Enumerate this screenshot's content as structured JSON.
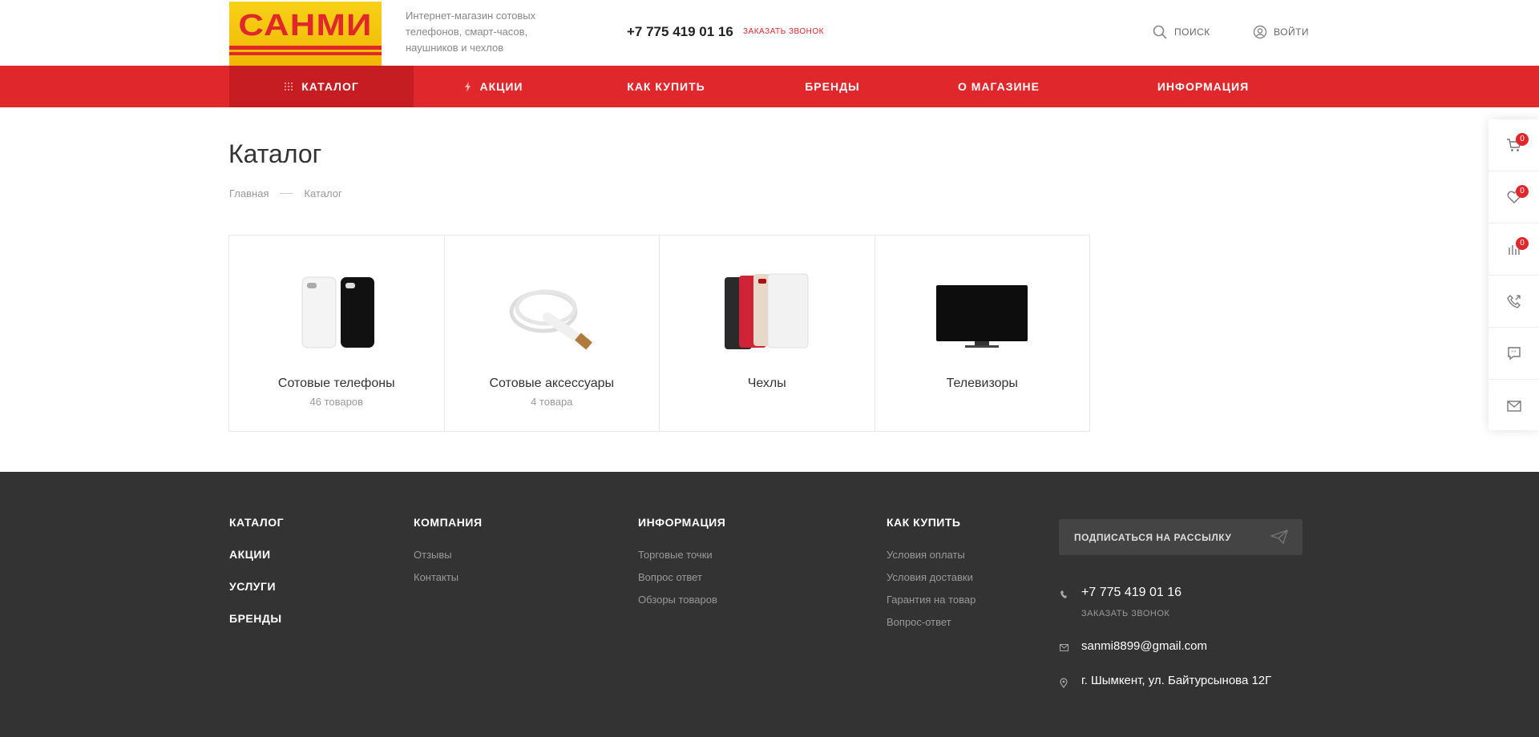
{
  "header": {
    "logo_text": "САНМИ",
    "tagline": "Интернет-магазин сотовых телефонов, смарт-часов, наушников и чехлов",
    "phone": "+7 775 419 01 16",
    "callback_label": "ЗАКАЗАТЬ ЗВОНОК",
    "search_label": "ПОИСК",
    "login_label": "ВОЙТИ"
  },
  "nav": {
    "items": [
      {
        "label": "КАТАЛОГ",
        "icon": "grid-dots-icon"
      },
      {
        "label": "АКЦИИ",
        "icon": "lightning-icon"
      },
      {
        "label": "КАК КУПИТЬ"
      },
      {
        "label": "БРЕНДЫ"
      },
      {
        "label": "О МАГАЗИНЕ"
      },
      {
        "label": "ИНФОРМАЦИЯ"
      }
    ]
  },
  "main": {
    "title": "Каталог",
    "breadcrumb": [
      "Главная",
      "Каталог"
    ],
    "categories": [
      {
        "name": "Сотовые телефоны",
        "count": "46 товаров"
      },
      {
        "name": "Сотовые аксессуары",
        "count": "4 товара"
      },
      {
        "name": "Чехлы",
        "count": ""
      },
      {
        "name": "Телевизоры",
        "count": ""
      }
    ]
  },
  "side_panel": {
    "items": [
      {
        "icon": "cart-icon",
        "badge": "0"
      },
      {
        "icon": "heart-icon",
        "badge": "0"
      },
      {
        "icon": "compare-icon",
        "badge": "0"
      },
      {
        "icon": "phone-callback-icon"
      },
      {
        "icon": "chat-icon"
      },
      {
        "icon": "mail-icon"
      }
    ]
  },
  "footer": {
    "col1": [
      "КАТАЛОГ",
      "АКЦИИ",
      "УСЛУГИ",
      "БРЕНДЫ"
    ],
    "col2": {
      "head": "КОМПАНИЯ",
      "links": [
        "Отзывы",
        "Контакты"
      ]
    },
    "col3": {
      "head": "ИНФОРМАЦИЯ",
      "links": [
        "Торговые точки",
        "Вопрос ответ",
        "Обзоры товаров"
      ]
    },
    "col4": {
      "head": "КАК КУПИТЬ",
      "links": [
        "Условия оплаты",
        "Условия доставки",
        "Гарантия на товар",
        "Вопрос-ответ"
      ]
    },
    "subscribe_label": "ПОДПИСАТЬСЯ НА РАССЫЛКУ",
    "phone": "+7 775 419 01 16",
    "callback_label": "ЗАКАЗАТЬ ЗВОНОК",
    "email": "sanmi8899@gmail.com",
    "address": "г. Шымкент, ул. Байтурсынова 12Г"
  },
  "colors": {
    "accent": "#e0272c",
    "accent_dark": "#c61d22",
    "footer_bg": "#333333",
    "logo_yellow": "#f7d117"
  }
}
